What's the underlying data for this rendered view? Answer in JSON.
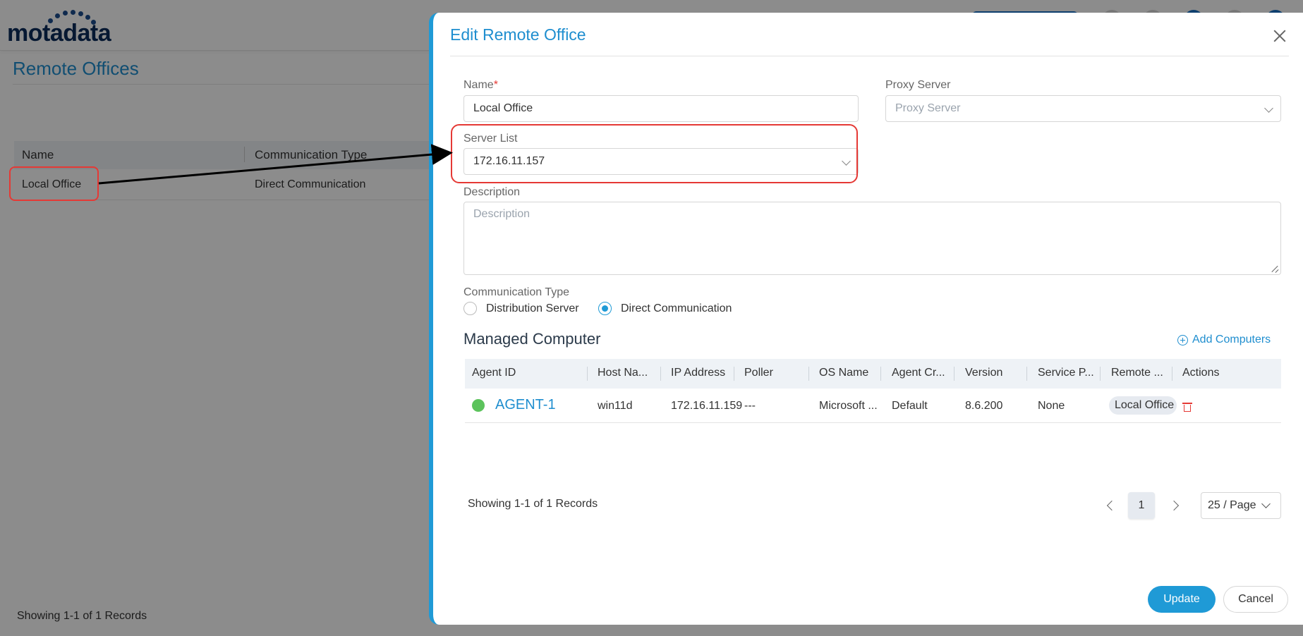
{
  "app": {
    "logo_text": "motadata",
    "page_title": "Remote Offices",
    "table": {
      "columns": [
        "Name",
        "Communication Type"
      ],
      "rows": [
        {
          "name": "Local Office",
          "communication_type": "Direct Communication"
        }
      ]
    },
    "footer": "Showing 1-1 of 1 Records"
  },
  "drawer": {
    "title": "Edit Remote Office",
    "name": {
      "label": "Name",
      "required_mark": "*",
      "value": "Local Office"
    },
    "proxy_server": {
      "label": "Proxy Server",
      "placeholder": "Proxy Server"
    },
    "server_list": {
      "label": "Server List",
      "value": "172.16.11.157"
    },
    "description": {
      "label": "Description",
      "placeholder": "Description"
    },
    "communication_type": {
      "label": "Communication Type",
      "options": [
        "Distribution Server",
        "Direct Communication"
      ],
      "selected": "Direct Communication"
    },
    "managed_computer": {
      "title": "Managed Computer",
      "add_label": "Add Computers",
      "columns": [
        "Agent ID",
        "Host Na...",
        "IP Address",
        "Poller",
        "OS Name",
        "Agent Cr...",
        "Version",
        "Service P...",
        "Remote ...",
        "Actions"
      ],
      "rows": [
        {
          "status": "online",
          "agent_id": "AGENT-1",
          "host_name": "win11d",
          "ip_address": "172.16.11.159",
          "poller": "---",
          "os_name": "Microsoft ...",
          "agent_created": "Default",
          "version": "8.6.200",
          "service_pack": "None",
          "remote_office": "Local Office"
        }
      ],
      "pager": {
        "summary": "Showing 1-1 of 1 Records",
        "current_page": "1",
        "page_size": "25 / Page"
      }
    },
    "buttons": {
      "update": "Update",
      "cancel": "Cancel"
    }
  },
  "colors": {
    "accent": "#1f9ad6",
    "highlight": "#e53935",
    "online": "#5cc35c"
  }
}
